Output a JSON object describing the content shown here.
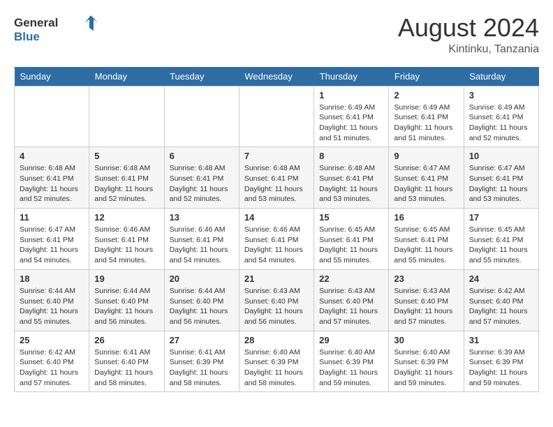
{
  "logo": {
    "text_general": "General",
    "text_blue": "Blue"
  },
  "title": {
    "month_year": "August 2024",
    "location": "Kintinku, Tanzania"
  },
  "weekdays": [
    "Sunday",
    "Monday",
    "Tuesday",
    "Wednesday",
    "Thursday",
    "Friday",
    "Saturday"
  ],
  "weeks": [
    [
      {
        "day": "",
        "info": ""
      },
      {
        "day": "",
        "info": ""
      },
      {
        "day": "",
        "info": ""
      },
      {
        "day": "",
        "info": ""
      },
      {
        "day": "1",
        "sunrise": "6:49 AM",
        "sunset": "6:41 PM",
        "daylight": "11 hours and 51 minutes."
      },
      {
        "day": "2",
        "sunrise": "6:49 AM",
        "sunset": "6:41 PM",
        "daylight": "11 hours and 51 minutes."
      },
      {
        "day": "3",
        "sunrise": "6:49 AM",
        "sunset": "6:41 PM",
        "daylight": "11 hours and 52 minutes."
      }
    ],
    [
      {
        "day": "4",
        "sunrise": "6:48 AM",
        "sunset": "6:41 PM",
        "daylight": "11 hours and 52 minutes."
      },
      {
        "day": "5",
        "sunrise": "6:48 AM",
        "sunset": "6:41 PM",
        "daylight": "11 hours and 52 minutes."
      },
      {
        "day": "6",
        "sunrise": "6:48 AM",
        "sunset": "6:41 PM",
        "daylight": "11 hours and 52 minutes."
      },
      {
        "day": "7",
        "sunrise": "6:48 AM",
        "sunset": "6:41 PM",
        "daylight": "11 hours and 53 minutes."
      },
      {
        "day": "8",
        "sunrise": "6:48 AM",
        "sunset": "6:41 PM",
        "daylight": "11 hours and 53 minutes."
      },
      {
        "day": "9",
        "sunrise": "6:47 AM",
        "sunset": "6:41 PM",
        "daylight": "11 hours and 53 minutes."
      },
      {
        "day": "10",
        "sunrise": "6:47 AM",
        "sunset": "6:41 PM",
        "daylight": "11 hours and 53 minutes."
      }
    ],
    [
      {
        "day": "11",
        "sunrise": "6:47 AM",
        "sunset": "6:41 PM",
        "daylight": "11 hours and 54 minutes."
      },
      {
        "day": "12",
        "sunrise": "6:46 AM",
        "sunset": "6:41 PM",
        "daylight": "11 hours and 54 minutes."
      },
      {
        "day": "13",
        "sunrise": "6:46 AM",
        "sunset": "6:41 PM",
        "daylight": "11 hours and 54 minutes."
      },
      {
        "day": "14",
        "sunrise": "6:46 AM",
        "sunset": "6:41 PM",
        "daylight": "11 hours and 54 minutes."
      },
      {
        "day": "15",
        "sunrise": "6:45 AM",
        "sunset": "6:41 PM",
        "daylight": "11 hours and 55 minutes."
      },
      {
        "day": "16",
        "sunrise": "6:45 AM",
        "sunset": "6:41 PM",
        "daylight": "11 hours and 55 minutes."
      },
      {
        "day": "17",
        "sunrise": "6:45 AM",
        "sunset": "6:41 PM",
        "daylight": "11 hours and 55 minutes."
      }
    ],
    [
      {
        "day": "18",
        "sunrise": "6:44 AM",
        "sunset": "6:40 PM",
        "daylight": "11 hours and 55 minutes."
      },
      {
        "day": "19",
        "sunrise": "6:44 AM",
        "sunset": "6:40 PM",
        "daylight": "11 hours and 56 minutes."
      },
      {
        "day": "20",
        "sunrise": "6:44 AM",
        "sunset": "6:40 PM",
        "daylight": "11 hours and 56 minutes."
      },
      {
        "day": "21",
        "sunrise": "6:43 AM",
        "sunset": "6:40 PM",
        "daylight": "11 hours and 56 minutes."
      },
      {
        "day": "22",
        "sunrise": "6:43 AM",
        "sunset": "6:40 PM",
        "daylight": "11 hours and 57 minutes."
      },
      {
        "day": "23",
        "sunrise": "6:43 AM",
        "sunset": "6:40 PM",
        "daylight": "11 hours and 57 minutes."
      },
      {
        "day": "24",
        "sunrise": "6:42 AM",
        "sunset": "6:40 PM",
        "daylight": "11 hours and 57 minutes."
      }
    ],
    [
      {
        "day": "25",
        "sunrise": "6:42 AM",
        "sunset": "6:40 PM",
        "daylight": "11 hours and 57 minutes."
      },
      {
        "day": "26",
        "sunrise": "6:41 AM",
        "sunset": "6:40 PM",
        "daylight": "11 hours and 58 minutes."
      },
      {
        "day": "27",
        "sunrise": "6:41 AM",
        "sunset": "6:39 PM",
        "daylight": "11 hours and 58 minutes."
      },
      {
        "day": "28",
        "sunrise": "6:40 AM",
        "sunset": "6:39 PM",
        "daylight": "11 hours and 58 minutes."
      },
      {
        "day": "29",
        "sunrise": "6:40 AM",
        "sunset": "6:39 PM",
        "daylight": "11 hours and 59 minutes."
      },
      {
        "day": "30",
        "sunrise": "6:40 AM",
        "sunset": "6:39 PM",
        "daylight": "11 hours and 59 minutes."
      },
      {
        "day": "31",
        "sunrise": "6:39 AM",
        "sunset": "6:39 PM",
        "daylight": "11 hours and 59 minutes."
      }
    ]
  ]
}
